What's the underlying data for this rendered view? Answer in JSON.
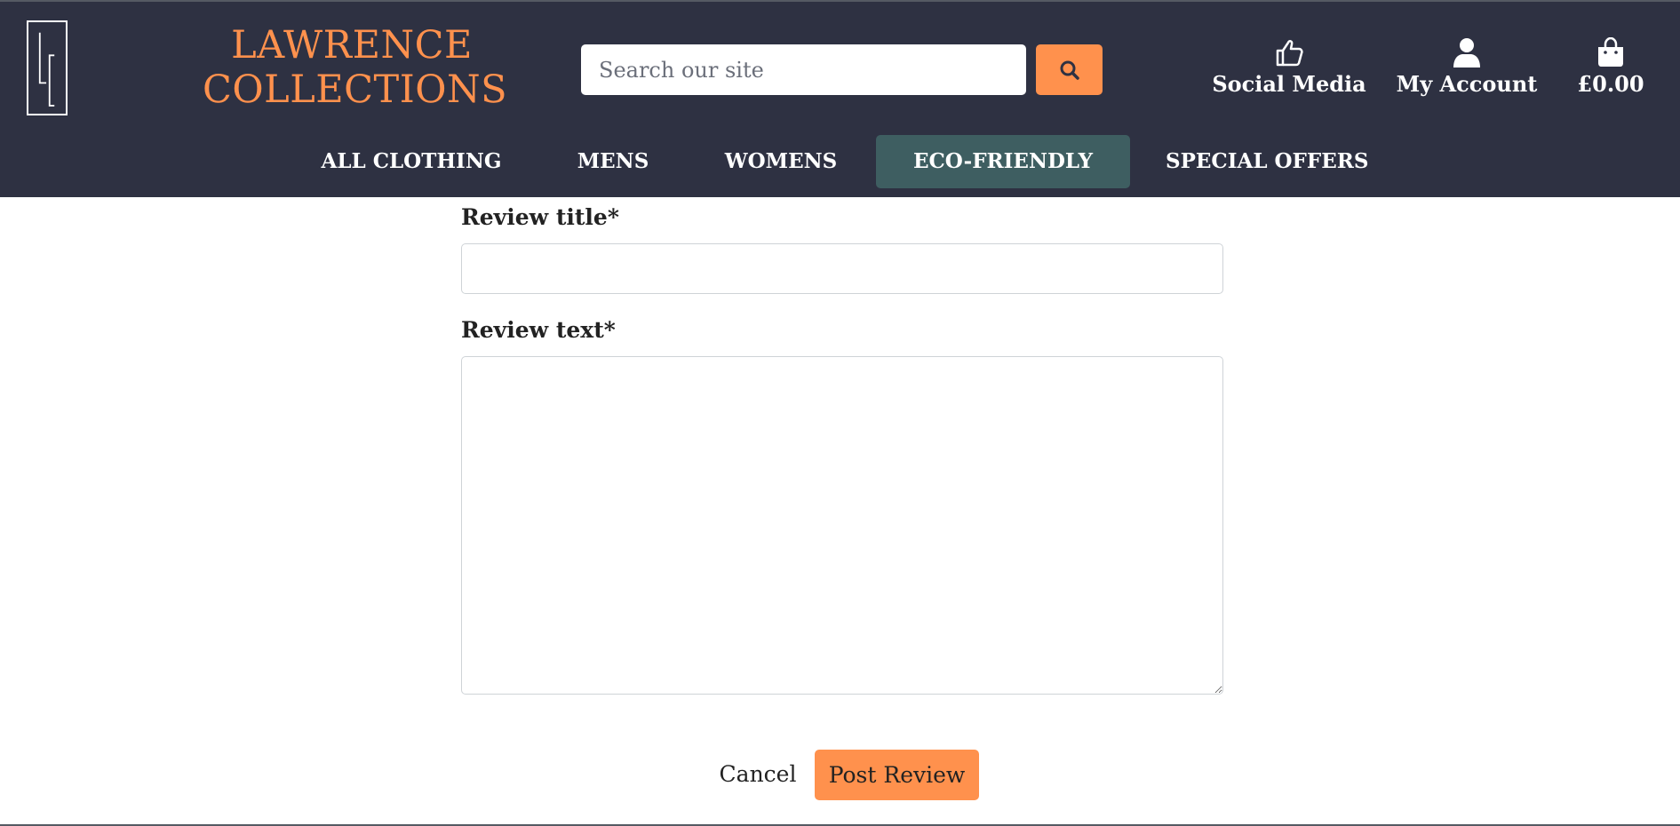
{
  "brand": {
    "line1": "LAWRENCE",
    "line2": "COLLECTIONS",
    "logo_text": "LC",
    "color": "#ff914d"
  },
  "search": {
    "placeholder": "Search our site",
    "button_icon": "search-icon"
  },
  "header_links": [
    {
      "label": "Social Media",
      "icon": "thumbs-up-icon"
    },
    {
      "label": "My Account",
      "icon": "user-icon"
    },
    {
      "label": "£0.00",
      "icon": "shopping-bag-icon"
    }
  ],
  "nav": [
    {
      "label": "ALL CLOTHING",
      "active": false
    },
    {
      "label": "MENS",
      "active": false
    },
    {
      "label": "WOMENS",
      "active": false
    },
    {
      "label": "ECO-FRIENDLY",
      "active": true
    },
    {
      "label": "SPECIAL OFFERS",
      "active": false
    }
  ],
  "form": {
    "title_label": "Review title*",
    "title_value": "",
    "text_label": "Review text*",
    "text_value": "",
    "cancel_label": "Cancel",
    "submit_label": "Post Review"
  },
  "colors": {
    "header_bg": "#2e3142",
    "accent": "#ff914d",
    "nav_active_bg": "#3e5e61"
  }
}
